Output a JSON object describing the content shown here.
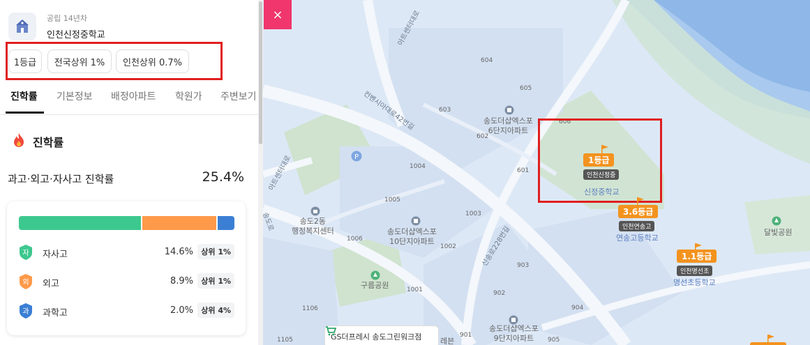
{
  "school": {
    "subtitle": "공립 14년차",
    "name": "인천신정중학교",
    "tags": [
      "1등급",
      "전국상위 1%",
      "인천상위 0.7%"
    ]
  },
  "tabs": [
    "진학률",
    "기본정보",
    "배정아파트",
    "학원가",
    "주변보기"
  ],
  "section": {
    "title": "진학률",
    "metric_label": "과고·외고·자사고 진학률",
    "metric_value": "25.4%",
    "breakdown": [
      {
        "badge": "자",
        "label": "자사고",
        "percent": "14.6%",
        "rank": "상위 1%",
        "color": "#3dc88f"
      },
      {
        "badge": "외",
        "label": "외고",
        "percent": "8.9%",
        "rank": "상위 1%",
        "color": "#ff9a4a"
      },
      {
        "badge": "과",
        "label": "과학고",
        "percent": "2.0%",
        "rank": "상위 4%",
        "color": "#3b7fd4"
      }
    ],
    "bar_shares": [
      14.6,
      8.9,
      2.0
    ]
  },
  "map": {
    "close_icon": "×",
    "places": [
      "송도더샵엑스포\n6단지아파트",
      "송도더샵엑스포\n10단지아파트",
      "송도더샵엑스포\n9단지아파트",
      "송도2동\n행정복지센터",
      "구름공원",
      "달빛공원",
      "신정중학교",
      "연송고등학교",
      "명선초등학교"
    ],
    "roads": [
      "아트센터대로",
      "컨벤시아대로42번길",
      "아트센터대로",
      "송도로",
      "신송로228번길"
    ],
    "buildings": [
      "604",
      "605",
      "603",
      "602",
      "606",
      "601",
      "1004",
      "1005",
      "1003",
      "1006",
      "1002",
      "903",
      "1001",
      "902",
      "1106",
      "904",
      "1105",
      "901",
      "905"
    ],
    "pins": [
      {
        "grade": "1등급",
        "name": "인천신정중"
      },
      {
        "grade": "3.6등급",
        "name": "인천연송고"
      },
      {
        "grade": "1.1등급",
        "name": "인천명선초"
      }
    ],
    "store": "GS더프레시 송도그린워크점",
    "store_trailing": "레븐"
  },
  "colors": {
    "accent_red": "#e01f1f",
    "grade_orange": "#f3931f",
    "close_pink": "#f0366c"
  }
}
